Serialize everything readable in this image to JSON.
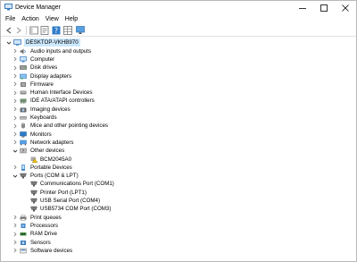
{
  "window": {
    "title": "Device Manager"
  },
  "menu": [
    "File",
    "Action",
    "View",
    "Help"
  ],
  "tree": {
    "root": "DESKTOP-VKHB970",
    "categories": [
      {
        "label": "Audio inputs and outputs",
        "icon": "speaker-icon",
        "expanded": false
      },
      {
        "label": "Computer",
        "icon": "computer-icon",
        "expanded": false
      },
      {
        "label": "Disk drives",
        "icon": "disk-drive-icon",
        "expanded": false
      },
      {
        "label": "Display adapters",
        "icon": "display-adapter-icon",
        "expanded": false
      },
      {
        "label": "Firmware",
        "icon": "firmware-icon",
        "expanded": false
      },
      {
        "label": "Human Interface Devices",
        "icon": "hid-icon",
        "expanded": false
      },
      {
        "label": "IDE ATA/ATAPI controllers",
        "icon": "ide-controller-icon",
        "expanded": false
      },
      {
        "label": "Imaging devices",
        "icon": "camera-icon",
        "expanded": false
      },
      {
        "label": "Keyboards",
        "icon": "keyboard-icon",
        "expanded": false
      },
      {
        "label": "Mice and other pointing devices",
        "icon": "mouse-icon",
        "expanded": false
      },
      {
        "label": "Monitors",
        "icon": "monitor-icon",
        "expanded": false
      },
      {
        "label": "Network adapters",
        "icon": "network-adapter-icon",
        "expanded": false
      },
      {
        "label": "Other devices",
        "icon": "unknown-device-icon",
        "expanded": true,
        "children": [
          {
            "label": "BCM2045A0",
            "icon": "warning-device-icon"
          }
        ]
      },
      {
        "label": "Portable Devices",
        "icon": "portable-device-icon",
        "expanded": false
      },
      {
        "label": "Ports (COM & LPT)",
        "icon": "port-icon",
        "expanded": true,
        "children": [
          {
            "label": "Communications Port (COM1)",
            "icon": "port-icon"
          },
          {
            "label": "Printer Port (LPT1)",
            "icon": "port-icon"
          },
          {
            "label": "USB Serial Port (COM4)",
            "icon": "port-icon"
          },
          {
            "label": "USB5734 COM Port (COM3)",
            "icon": "port-icon"
          }
        ]
      },
      {
        "label": "Print queues",
        "icon": "printer-icon",
        "expanded": false
      },
      {
        "label": "Processors",
        "icon": "processor-icon",
        "expanded": false
      },
      {
        "label": "RAM Drive",
        "icon": "ram-drive-icon",
        "expanded": false
      },
      {
        "label": "Sensors",
        "icon": "sensor-icon",
        "expanded": false
      },
      {
        "label": "Software devices",
        "icon": "software-device-icon",
        "expanded": false
      }
    ]
  },
  "colors": {
    "selection": "#cce8ff",
    "icon_blue": "#2f7bc8",
    "icon_gray": "#6d6d6d",
    "warning": "#f2c200"
  }
}
